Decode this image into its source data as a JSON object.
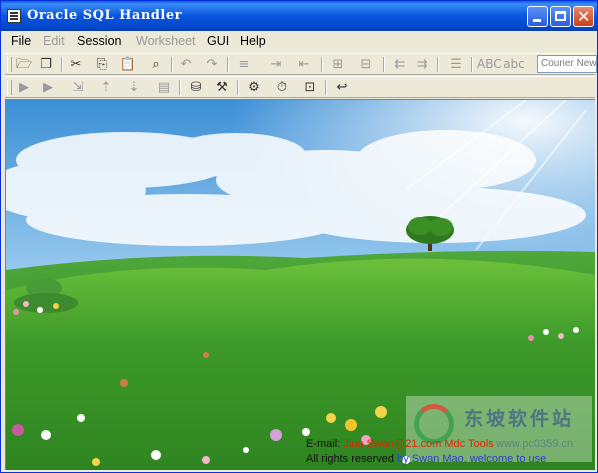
{
  "window": {
    "title": "Oracle SQL Handler"
  },
  "menu": [
    {
      "label": "File",
      "enabled": true
    },
    {
      "label": "Edit",
      "enabled": false
    },
    {
      "label": "Session",
      "enabled": true
    },
    {
      "label": "Worksheet",
      "enabled": false
    },
    {
      "label": "GUI",
      "enabled": true
    },
    {
      "label": "Help",
      "enabled": true
    }
  ],
  "toolbar": {
    "font_selector": "Courier New",
    "case_upper_label": "ABC",
    "case_lower_label": "abc"
  },
  "footer": {
    "email_prefix": "E-mail:",
    "email_value": "Jinn Swan@21.com Mdc Tools",
    "rights_text": "All rights reserved",
    "credit_text": "by Swan Mao, welcome to use"
  },
  "watermark": {
    "brand": "东坡软件站",
    "url": "www.pc0359.cn"
  },
  "colors": {
    "titlebar": "#0855dd",
    "sky_top": "#3b8fd6",
    "grass": "#3d9a2a",
    "email_accent": "#d82a00",
    "credit_accent": "#2a3fd0"
  }
}
